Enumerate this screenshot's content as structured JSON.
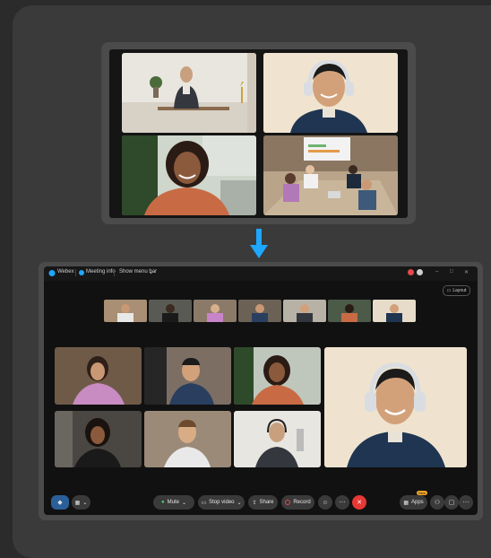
{
  "titlebar": {
    "app_name": "Webex",
    "meeting_info": "Meeting info",
    "show_menu_bar": "Show menu bar"
  },
  "layout_button": {
    "label": "Layout"
  },
  "toolbar": {
    "mute": "Mute",
    "stop_video": "Stop video",
    "share": "Share",
    "record": "Record",
    "apps": "Apps",
    "apps_badge": "New"
  },
  "colors": {
    "arrow": "#1ea7ff",
    "record_red": "#e5484d",
    "end_red": "#e53935",
    "brand_blue": "#1ea7ff"
  }
}
